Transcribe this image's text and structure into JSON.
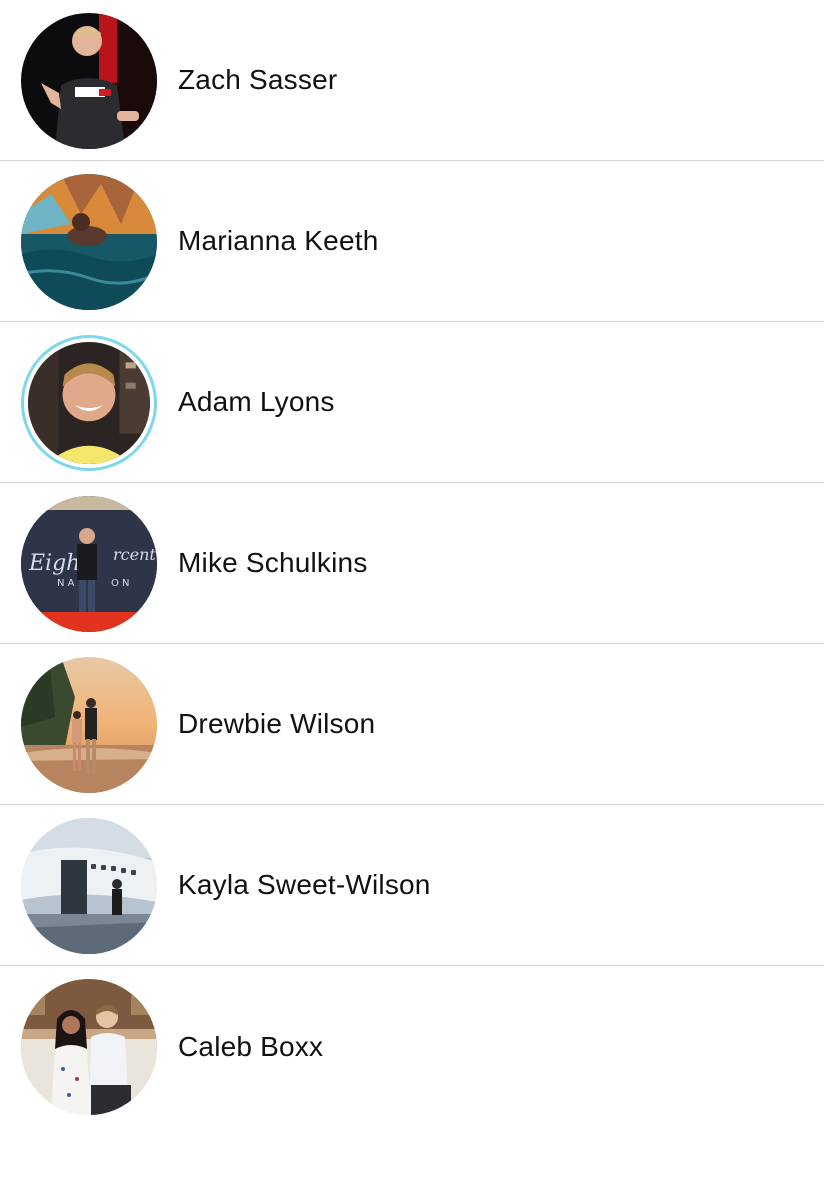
{
  "contacts": [
    {
      "name": "Zach Sasser",
      "avatar_icon": "person-photo-icon"
    },
    {
      "name": "Marianna Keeth",
      "avatar_icon": "pool-photo-icon"
    },
    {
      "name": "Adam Lyons",
      "avatar_icon": "selfie-photo-icon"
    },
    {
      "name": "Mike Schulkins",
      "avatar_icon": "stage-photo-icon"
    },
    {
      "name": "Drewbie Wilson",
      "avatar_icon": "beach-sunset-photo-icon"
    },
    {
      "name": "Kayla Sweet-Wilson",
      "avatar_icon": "private-jet-photo-icon"
    },
    {
      "name": "Caleb Boxx",
      "avatar_icon": "couple-photo-icon"
    }
  ],
  "avatar_story_ring_color": "#7fd8ea",
  "divider_color": "#d3d3d6"
}
